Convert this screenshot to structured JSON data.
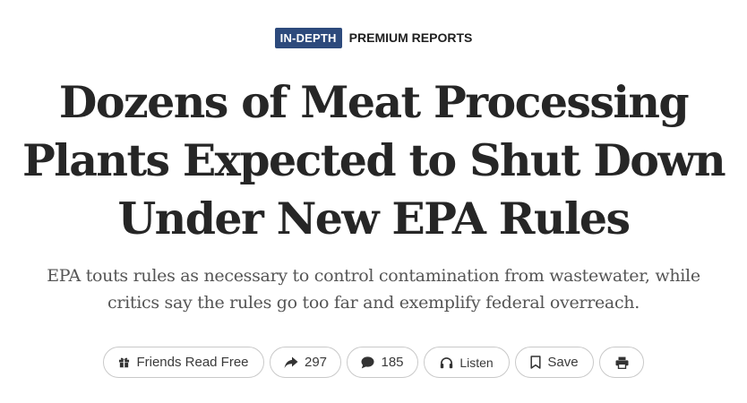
{
  "kicker": {
    "badge": "IN-DEPTH",
    "section": "PREMIUM REPORTS"
  },
  "article": {
    "headline_lines": [
      "Dozens of Meat Processing",
      "Plants Expected to Shut Down",
      "Under New EPA Rules"
    ],
    "dek_lines": [
      "EPA touts rules as necessary to control contamination from wastewater, while",
      "critics say the rules go too far and exemplify federal overreach."
    ]
  },
  "toolbar": {
    "friends_label": "Friends Read Free",
    "share_count": "297",
    "comment_count": "185",
    "listen_label": "Listen",
    "save_label": "Save"
  },
  "icons": {
    "friends": "gift-icon",
    "share": "share-arrow-icon",
    "comment": "comment-bubble-icon",
    "listen": "headphones-icon",
    "save": "bookmark-icon",
    "print": "printer-icon"
  },
  "colors": {
    "badge_background": "#2d4a7c",
    "headline": "#262626",
    "dek": "#555555",
    "button_border": "#c9c9c9"
  }
}
